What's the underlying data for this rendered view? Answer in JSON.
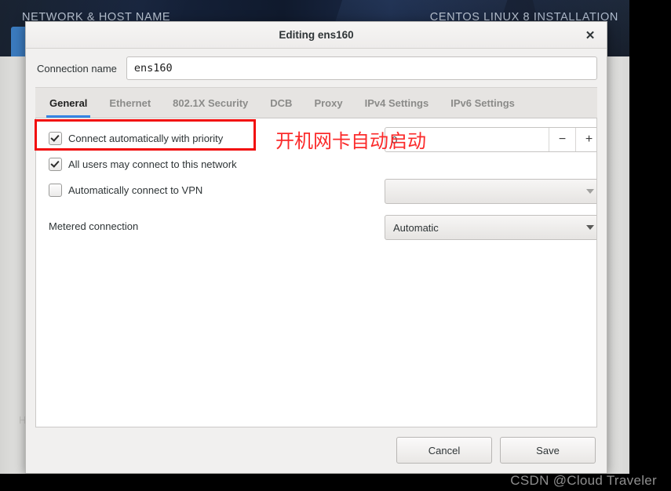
{
  "background": {
    "screen_title": "NETWORK & HOST NAME",
    "product_title": "CENTOS LINUX 8 INSTALLATION",
    "hint_text": "H"
  },
  "watermark": {
    "text": "CSDN @Cloud Traveler"
  },
  "dialog": {
    "title": "Editing ens160",
    "close_label": "✕",
    "connection_name": {
      "label": "Connection name",
      "value": "ens160",
      "placeholder": "Connection name"
    },
    "tabs": [
      {
        "label": "General",
        "active": true
      },
      {
        "label": "Ethernet",
        "active": false
      },
      {
        "label": "802.1X Security",
        "active": false
      },
      {
        "label": "DCB",
        "active": false
      },
      {
        "label": "Proxy",
        "active": false
      },
      {
        "label": "IPv4 Settings",
        "active": false
      },
      {
        "label": "IPv6 Settings",
        "active": false
      }
    ],
    "general": {
      "connect_automatically": {
        "label": "Connect automatically with priority",
        "checked": true
      },
      "all_users": {
        "label": "All users may connect to this network",
        "checked": true
      },
      "auto_vpn": {
        "label": "Automatically connect to VPN",
        "checked": false
      },
      "priority_spinner": {
        "value": "0",
        "minus_label": "−",
        "plus_label": "+"
      },
      "vpn_combo": {
        "value": ""
      },
      "metered": {
        "label": "Metered connection",
        "value": "Automatic"
      }
    },
    "footer": {
      "cancel_label": "Cancel",
      "save_label": "Save"
    }
  },
  "annotation": {
    "text": "开机网卡自动启动",
    "color": "#fb2a2a"
  }
}
